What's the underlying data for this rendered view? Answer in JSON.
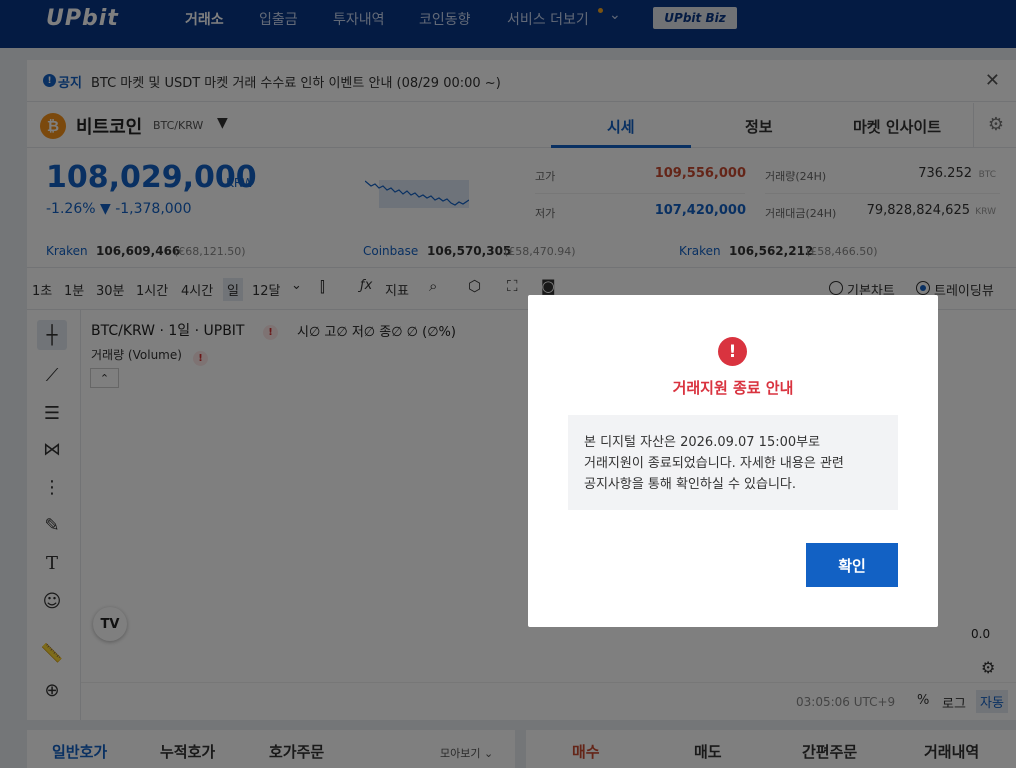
{
  "header": {
    "logo": "UPbit",
    "nav": [
      "거래소",
      "입출금",
      "투자내역",
      "코인동향",
      "서비스 더보기"
    ],
    "more_caret": "⌄",
    "biz_badge": "UPbit Biz"
  },
  "notice": {
    "label": "공지",
    "text": "BTC 마켓 및 USDT 마켓 거래 수수료 인하 이벤트 안내 (08/29 00:00 ~)"
  },
  "coin": {
    "name": "비트코인",
    "pair": "BTC/KRW",
    "tabs": [
      "시세",
      "정보",
      "마켓 인사이트"
    ]
  },
  "price": {
    "current": "108,029,000",
    "unit": "KRW",
    "change": "-1.26% ▼ -1,378,000",
    "high_label": "고가",
    "high": "109,556,000",
    "low_label": "저가",
    "low": "107,420,000",
    "volume_label": "거래량(24H)",
    "volume": "736.252",
    "volume_unit": "BTC",
    "amount_label": "거래대금(24H)",
    "amount": "79,828,824,625",
    "amount_unit": "KRW",
    "high_color": "#c84a31",
    "low_color": "#1261c4"
  },
  "exchanges": [
    {
      "name": "Kraken",
      "value": "106,609,466",
      "sub": "(€68,121.50)"
    },
    {
      "name": "Coinbase",
      "value": "106,570,305",
      "sub": "(£58,470.94)"
    },
    {
      "name": "Kraken",
      "value": "106,562,212",
      "sub": "(£58,466.50)"
    }
  ],
  "toolbar": {
    "intervals": [
      "1초",
      "1분",
      "30분",
      "1시간",
      "4시간",
      "일",
      "12달"
    ],
    "indicator_label": "지표",
    "basic_chart": "기본차트",
    "trading_view": "트레이딩뷰"
  },
  "chart": {
    "title": "BTC/KRW · 1일 · UPBIT",
    "ohlc": "시∅ 고∅ 저∅ 종∅ ∅ (∅%)",
    "volume_label": "거래량 (Volume)",
    "scale_zero": "0.0",
    "time": "03:05:06 UTC+9",
    "percent": "%",
    "log": "로그",
    "auto": "자동",
    "tv_logo": "TV"
  },
  "orderbook": {
    "tabs": [
      "일반호가",
      "누적호가",
      "호가주문"
    ],
    "group": "모아보기 ⌄"
  },
  "order": {
    "tabs": [
      "매수",
      "매도",
      "간편주문",
      "거래내역"
    ]
  },
  "modal": {
    "title": "거래지원 종료 안내",
    "body_line1": "본 디지털 자산은 2026.09.07 15:00부로",
    "body_line2": "거래지원이 종료되었습니다. 자세한 내용은 관련",
    "body_line3": "공지사항을 통해 확인하실 수 있습니다.",
    "confirm": "확인"
  }
}
